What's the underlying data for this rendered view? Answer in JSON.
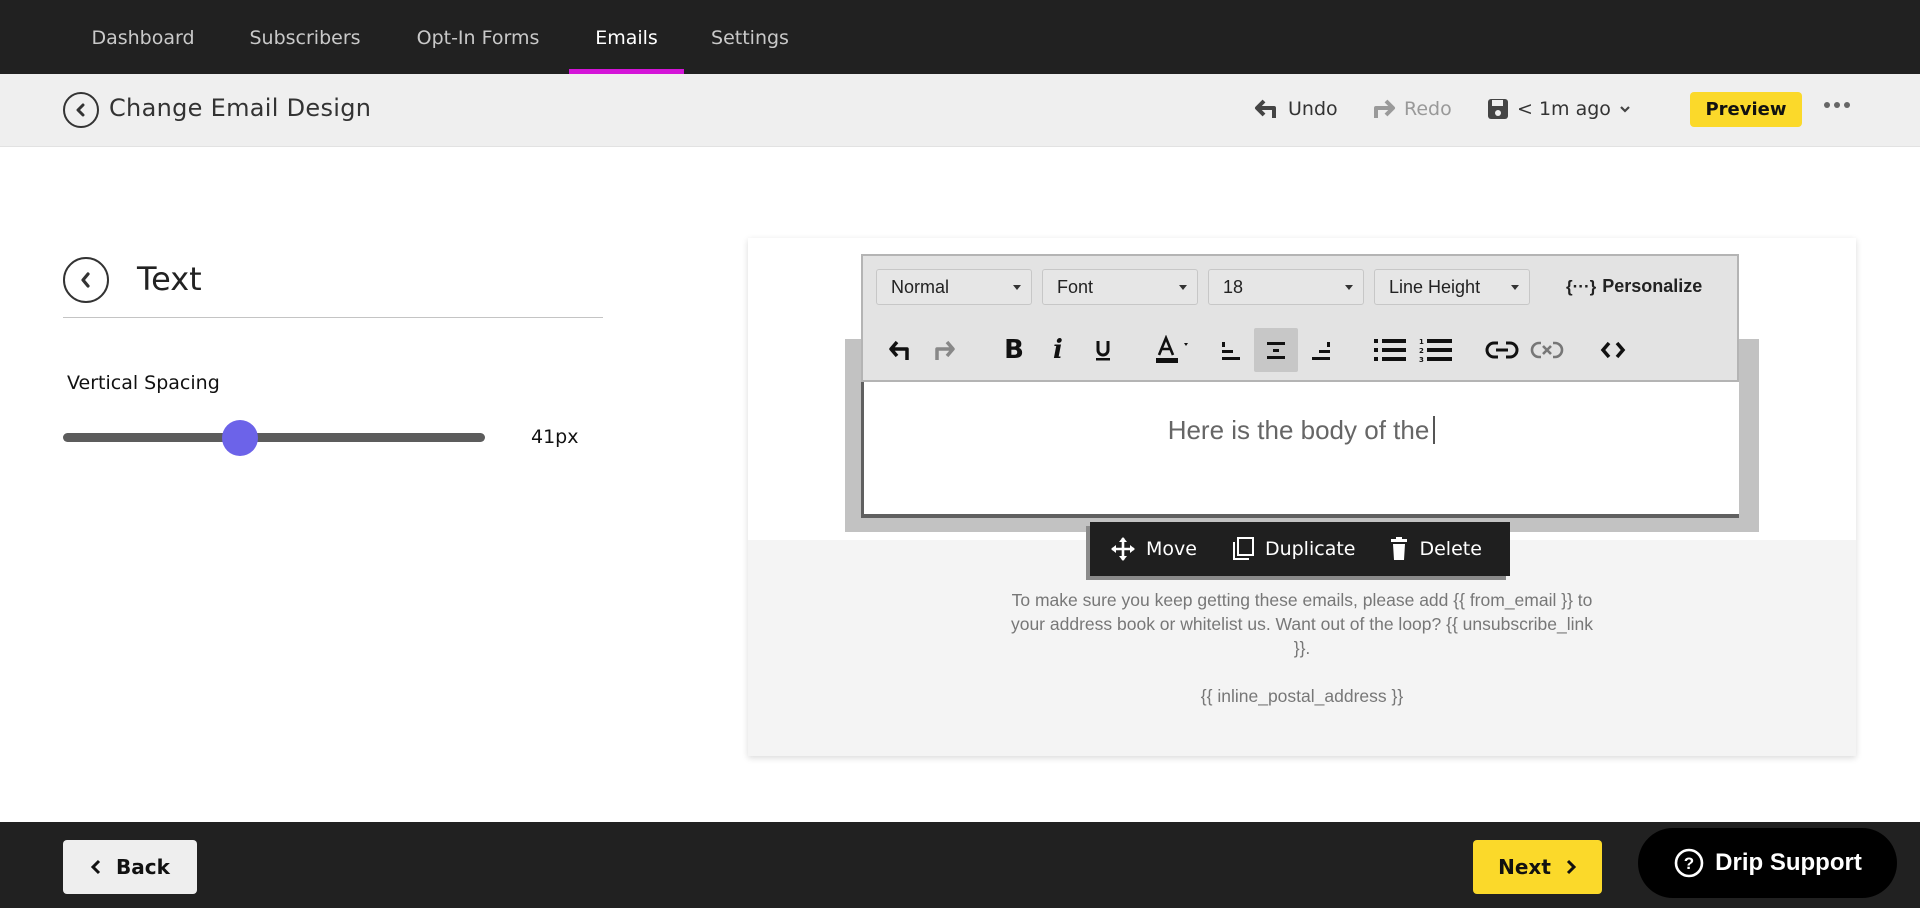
{
  "nav": {
    "tabs": [
      {
        "label": "Dashboard",
        "active": false
      },
      {
        "label": "Subscribers",
        "active": false
      },
      {
        "label": "Opt-In Forms",
        "active": false
      },
      {
        "label": "Emails",
        "active": true
      },
      {
        "label": "Settings",
        "active": false
      }
    ],
    "active_color": "#d414d8"
  },
  "header": {
    "title": "Change Email Design",
    "undo_label": "Undo",
    "redo_label": "Redo",
    "saved_label": "< 1m ago",
    "preview_label": "Preview"
  },
  "panel": {
    "title": "Text",
    "vertical_spacing": {
      "label": "Vertical Spacing",
      "value_label": "41px",
      "value_fraction": 0.42
    }
  },
  "editor": {
    "dropdowns": {
      "format": "Normal",
      "font": "Font",
      "size": "18",
      "line_height": "Line Height"
    },
    "personalize_label": "Personalize",
    "toolbar_buttons": [
      "undo-icon",
      "redo-icon",
      "bold-icon",
      "italic-icon",
      "underline-icon",
      "text-color-icon",
      "align-left-icon",
      "align-center-icon",
      "align-right-icon",
      "bullet-list-icon",
      "numbered-list-icon",
      "link-icon",
      "unlink-icon",
      "code-icon"
    ],
    "active_alignment": "center",
    "body_text": "Here is the body of the"
  },
  "block_actions": {
    "move_label": "Move",
    "duplicate_label": "Duplicate",
    "delete_label": "Delete"
  },
  "email_footer": {
    "notice": "To make sure you keep getting these emails, please add {{ from_email }} to your address book or whitelist us. Want out of the loop? {{ unsubscribe_link }}.",
    "address": "{{ inline_postal_address }}"
  },
  "bottom": {
    "back_label": "Back",
    "next_label": "Next",
    "support_label": "Drip Support"
  },
  "colors": {
    "accent_yellow": "#fbd92a",
    "slider_thumb": "#6c63e9",
    "dark_bar": "#212121"
  }
}
